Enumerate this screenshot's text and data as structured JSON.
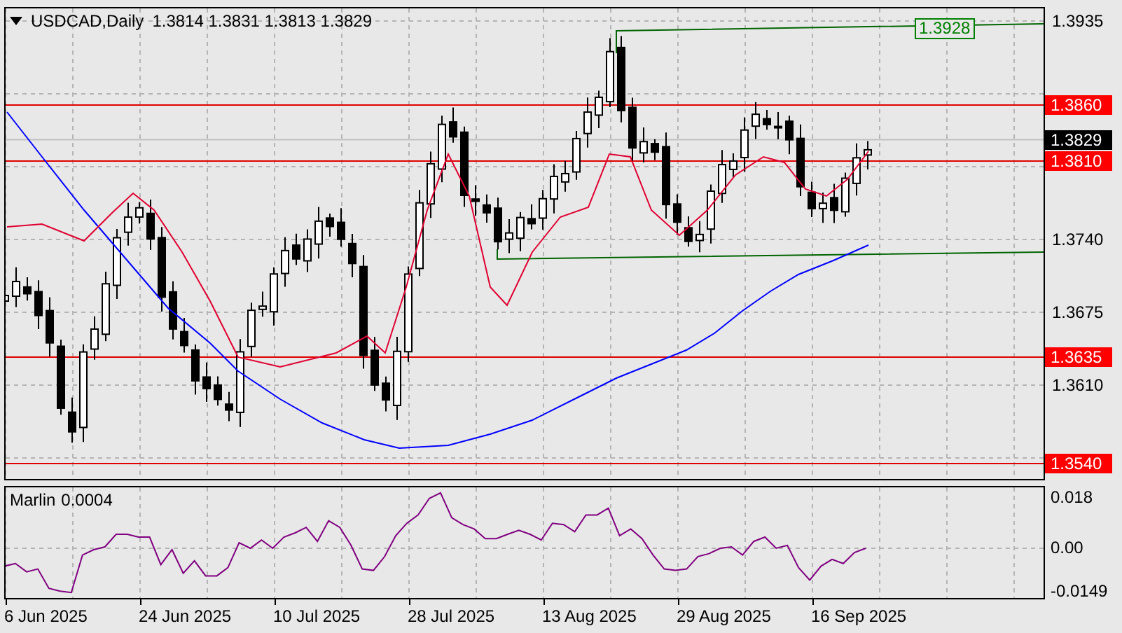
{
  "chart": {
    "symbol": "USDCAD,Daily",
    "ohlc": "1.3814 1.3831 1.3813 1.3829",
    "annotation": "1.3928",
    "price_axis": [
      {
        "kind": "tick",
        "label": "1.3935"
      },
      {
        "kind": "level",
        "label": "1.3860"
      },
      {
        "kind": "current",
        "label": "1.3829"
      },
      {
        "kind": "level",
        "label": "1.3810"
      },
      {
        "kind": "tick",
        "label": "1.3740"
      },
      {
        "kind": "tick",
        "label": "1.3675"
      },
      {
        "kind": "level",
        "label": "1.3635"
      },
      {
        "kind": "tick",
        "label": "1.3610"
      },
      {
        "kind": "level",
        "label": "1.3540"
      }
    ]
  },
  "indicator": {
    "value": "0.0004",
    "chart_data": {
      "type": "line",
      "grid": true,
      "ylim": [
        -0.0175,
        0.0219
      ],
      "yticks": [
        {
          "value": 0.018,
          "label": "0.018"
        },
        {
          "value": 0,
          "label": "0.00"
        },
        {
          "value": -0.0149,
          "label": "-0.0149"
        }
      ],
      "series": [
        {
          "name": "Marlin",
          "color": "#800080",
          "values": [
            -0.0063,
            -0.0054,
            -0.0083,
            -0.0073,
            -0.0141,
            -0.0151,
            -0.0156,
            -0.0024,
            -0.0005,
            0.0005,
            0.0049,
            0.0049,
            0.0039,
            0.0039,
            -0.0058,
            -0.0005,
            -0.0088,
            -0.0044,
            -0.0097,
            -0.0097,
            -0.0068,
            0.0019,
            0,
            0.0029,
            0,
            0.0039,
            0.0054,
            0.0073,
            0.0024,
            0.0097,
            0.0073,
            0.001,
            -0.0073,
            -0.0078,
            -0.0029,
            0.0044,
            0.0088,
            0.0117,
            0.0175,
            0.0195,
            0.0107,
            0.0083,
            0.0068,
            0.0034,
            0.0034,
            0.0049,
            0.0063,
            0.0049,
            0.0029,
            0.0088,
            0.0083,
            0.0058,
            0.0117,
            0.0117,
            0.0141,
            0.0044,
            0.0068,
            0.0034,
            -0.0024,
            -0.0073,
            -0.0078,
            -0.0073,
            -0.0029,
            -0.0019,
            0,
            0.0005,
            -0.0024,
            0.0024,
            0.0039,
            0,
            0.001,
            -0.0068,
            -0.0112,
            -0.0063,
            -0.0039,
            -0.0054,
            -0.0015,
            0
          ]
        }
      ]
    }
  },
  "time_axis": [
    "6 Jun 2025",
    "24 Jun 2025",
    "10 Jul 2025",
    "28 Jul 2025",
    "13 Aug 2025",
    "29 Aug 2025",
    "16 Sep 2025"
  ]
}
